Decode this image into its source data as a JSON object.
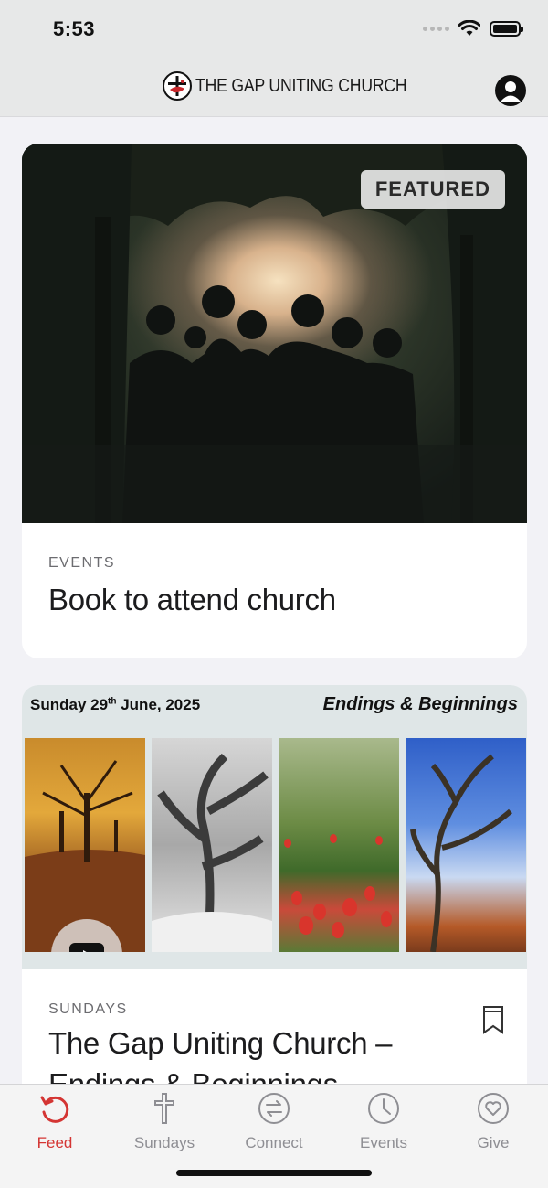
{
  "status_bar": {
    "time": "5:53"
  },
  "header": {
    "title": "THE GAP UNITING CHURCH",
    "profile_icon": "person-circle-icon"
  },
  "colors": {
    "accent": "#d43533",
    "tab_inactive": "#8e8e93",
    "header_bg": "#e7e8e8"
  },
  "feed": {
    "cards": [
      {
        "badge": "FEATURED",
        "category": "EVENTS",
        "title": "Book to attend church",
        "image": "silhouettes-in-forest-sunset"
      },
      {
        "banner_date_day": "Sunday 29",
        "banner_date_suffix": "th",
        "banner_date_rest": " June, 2025",
        "banner_series": "Endings & Beginnings",
        "category": "SUNDAYS",
        "title": "The Gap Uniting Church –",
        "title_cutoff": "Endings & Beginnings",
        "play_icon": "youtube-play-icon",
        "bookmark_icon": "bookmark-icon"
      }
    ]
  },
  "tabbar": {
    "tabs": [
      {
        "label": "Feed",
        "icon": "feed-refresh-icon",
        "active": true
      },
      {
        "label": "Sundays",
        "icon": "cross-icon",
        "active": false
      },
      {
        "label": "Connect",
        "icon": "connect-arrows-icon",
        "active": false
      },
      {
        "label": "Events",
        "icon": "clock-icon",
        "active": false
      },
      {
        "label": "Give",
        "icon": "heart-icon",
        "active": false
      }
    ]
  }
}
